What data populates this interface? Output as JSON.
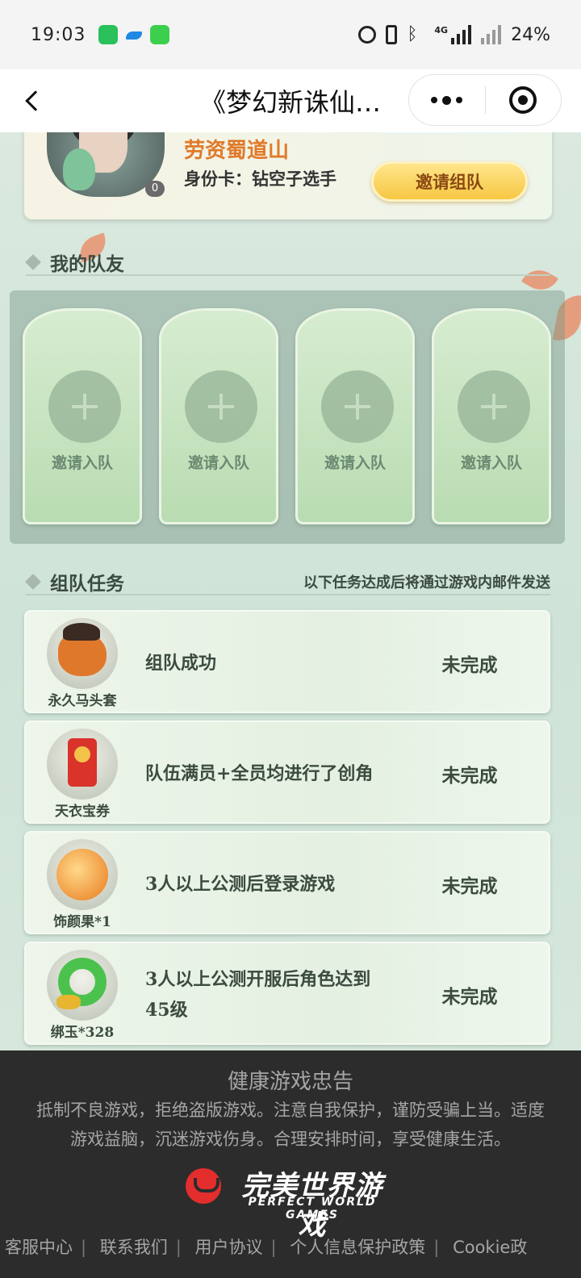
{
  "status_bar": {
    "time": "19:03",
    "network": "4G",
    "battery": "24%"
  },
  "nav": {
    "title": "《梦幻新诛仙…"
  },
  "profile": {
    "name": "劳资蜀道山",
    "id_card": "身份卡：钻空子选手",
    "avatar_badge": "0",
    "invite_team_label": "邀请组队"
  },
  "teammates": {
    "title": "我的队友",
    "slots": [
      {
        "label": "邀请入队"
      },
      {
        "label": "邀请入队"
      },
      {
        "label": "邀请入队"
      },
      {
        "label": "邀请入队"
      }
    ]
  },
  "tasks": {
    "title": "组队任务",
    "note": "以下任务达成后将通过游戏内邮件发送",
    "items": [
      {
        "reward": "永久马头套",
        "desc": "组队成功",
        "status": "未完成",
        "icon": "horse-head-icon"
      },
      {
        "reward": "天衣宝券",
        "desc": "队伍满员+全员均进行了创角",
        "status": "未完成",
        "icon": "ticket-icon"
      },
      {
        "reward": "饰颜果*1",
        "desc": "3人以上公测后登录游戏",
        "status": "未完成",
        "icon": "fruit-orb-icon"
      },
      {
        "reward": "绑玉*328",
        "desc": "3人以上公测开服后角色达到45级",
        "status": "未完成",
        "icon": "jade-icon"
      }
    ]
  },
  "footer": {
    "title": "健康游戏忠告",
    "body_line1": "抵制不良游戏，拒绝盗版游戏。注意自我保护，谨防受骗上当。适度",
    "body_line2": "游戏益脑，沉迷游戏伤身。合理安排时间，享受健康生活。",
    "brand_zh": "完美世界游戏",
    "brand_en": "PERFECT WORLD GAMES",
    "links": [
      "客服中心",
      "联系我们",
      "用户协议",
      "个人信息保护政策",
      "Cookie政"
    ]
  },
  "colors": {
    "accent_orange": "#e07a2a",
    "button_gold": "#f6c743",
    "footer_bg": "#2c2c2c"
  }
}
